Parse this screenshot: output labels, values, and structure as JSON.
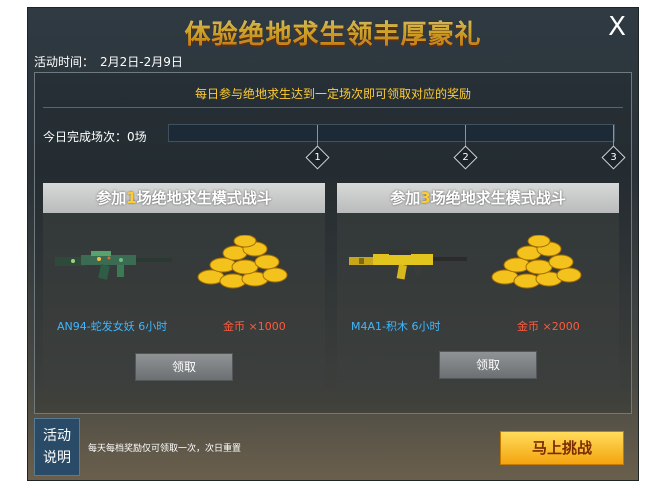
{
  "window": {
    "title": "体验绝地求生领丰厚豪礼",
    "close_glyph": "X"
  },
  "event": {
    "time_label": "活动时间：",
    "time_value": "2月2日-2月9日"
  },
  "notice": "每日参与绝地求生达到一定场次即可领取对应的奖励",
  "progress": {
    "label": "今日完成场次：0场",
    "completed": 0,
    "fill_fraction": 0,
    "milestones": [
      "1",
      "2",
      "3"
    ]
  },
  "cards": [
    {
      "head_prefix": "参加",
      "head_num": "1",
      "head_suffix": "场绝地求生模式战斗",
      "item_name": "AN94-蛇发女妖 6小时",
      "coin_text": "金币 ×1000",
      "button_label": "领取",
      "gun_icon": "rifle-camo-icon"
    },
    {
      "head_prefix": "参加",
      "head_num": "3",
      "head_suffix": "场绝地求生模式战斗",
      "item_name": "M4A1-积木 6小时",
      "coin_text": "金币 ×2000",
      "button_label": "领取",
      "gun_icon": "rifle-yellow-icon"
    }
  ],
  "footer": {
    "tab_line1": "活动",
    "tab_line2": "说明",
    "note": "每天每档奖励仅可领取一次，次日重置",
    "cta_label": "马上挑战"
  },
  "colors": {
    "accent": "#ffcc33",
    "link_blue": "#3fb7ff",
    "coin_red": "#ff5a3c"
  }
}
